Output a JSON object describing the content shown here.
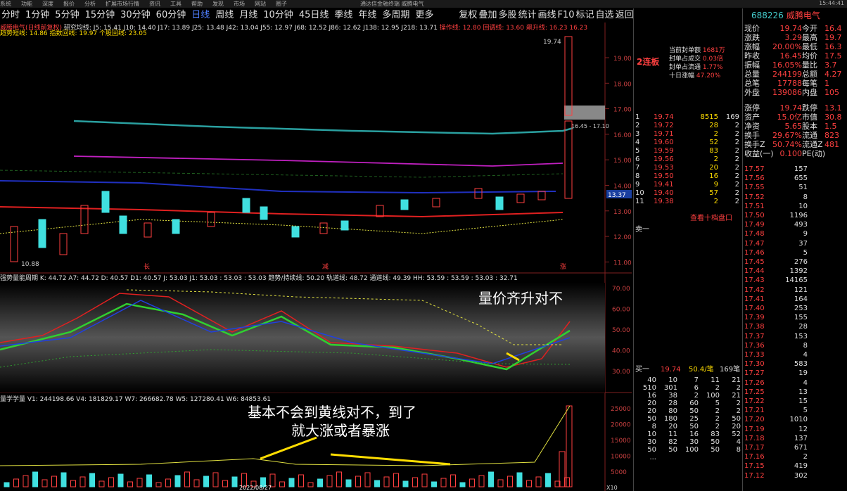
{
  "menu": [
    "系统",
    "功能",
    "深度",
    "报价",
    "分析",
    "扩展市场行情",
    "资讯",
    "工具",
    "帮助",
    "发现",
    "市场",
    "网站",
    "圈子"
  ],
  "window_title": "通达信金融终端  威腾电气",
  "clock": "15:44:41",
  "periods": [
    "分时",
    "1分钟",
    "5分钟",
    "15分钟",
    "30分钟",
    "60分钟",
    "日线",
    "周线",
    "月线",
    "10分钟",
    "45日线",
    "季线",
    "年线",
    "多周期",
    "更多"
  ],
  "selected_period": "日线",
  "toolbar_right": [
    "复权",
    "叠加",
    "多股",
    "统计",
    "画线",
    "F10",
    "标记",
    "自选",
    "返回"
  ],
  "chart": {
    "title": "威腾电气(日线前复权)",
    "legend1": "研究均线: J5: 15.41  J10: 14.40  J17: 13.89  J25: 13.48  J42: 13.04  J55: 12.97  J68: 12.52  J86: 12.62  J138: 12.95  J218: 13.71",
    "legend1b": "操作线: 12.80  回调线: 13.60  飙升线: 16.23  16.23",
    "legend2": "趋势短线: 14.86  指数回线: 19.97  个股回线: 23.05",
    "price_axis": [
      "19.00",
      "18.00",
      "17.00",
      "16.00",
      "15.00",
      "14.00",
      "13.00",
      "12.00",
      "11.00"
    ],
    "current_price": "13.37",
    "high_label": "19.74",
    "low_label": "10.88",
    "range_label": "16.45 - 17.10",
    "panel2_title": "强势量能周期  K: 44.72  A7: 44.72  D: 40.57  D1: 40.57  J: 53.03  J1: 53.03  : 53.03  : 53.03  趋势/持续线: 50.20  轨道线: 48.72  通道线: 49.39  HH: 53.59  : 53.59  : 53.03  : 32.71",
    "panel2_axis": [
      "70.00",
      "60.00",
      "50.00",
      "40.00",
      "30.00"
    ],
    "panel3_title": "量学学量  V1: 244198.66  V4: 181829.17  W7: 266682.78  W5: 127280.41  W6: 84853.61",
    "panel3_axis": [
      "25000",
      "20000",
      "15000",
      "10000",
      "5000"
    ],
    "date_label": "2022/08/27",
    "vol_unit": "X10",
    "annotation1": "量价齐升对不",
    "annotation2_line1": "基本不会到黄线对不，到了",
    "annotation2_line2": "就大涨或者暴涨",
    "xmarks": [
      "长",
      "减",
      "涨"
    ]
  },
  "side": {
    "streak": "2连板",
    "seal": [
      [
        "当前封单额",
        "1681万"
      ],
      [
        "封单占成交",
        "0.03倍"
      ],
      [
        "封单占流通",
        "1.77%"
      ],
      [
        "十日涨幅",
        "47.20%"
      ]
    ],
    "book_rows": [
      [
        "1",
        "19.74",
        "8515",
        "169"
      ],
      [
        "2",
        "19.72",
        "28",
        "2"
      ],
      [
        "3",
        "19.71",
        "2",
        "2"
      ],
      [
        "4",
        "19.60",
        "52",
        "2"
      ],
      [
        "5",
        "19.59",
        "83",
        "2"
      ],
      [
        "6",
        "19.56",
        "2",
        "2"
      ],
      [
        "7",
        "19.53",
        "20",
        "2"
      ],
      [
        "8",
        "19.50",
        "16",
        "2"
      ],
      [
        "9",
        "19.41",
        "9",
        "2"
      ],
      [
        "10",
        "19.40",
        "57",
        "2"
      ],
      [
        "11",
        "19.38",
        "2",
        "2"
      ]
    ],
    "ten_level": "查看十档盘口",
    "sell_label": "卖一",
    "buy_label": "买一",
    "buy_row": [
      "19.74",
      "50.4/笔",
      "169笔"
    ],
    "queue": [
      [
        "40",
        "10",
        "7",
        "11",
        "21"
      ],
      [
        "510",
        "301",
        "6",
        "2",
        "2"
      ],
      [
        "16",
        "38",
        "2",
        "100",
        "21"
      ],
      [
        "20",
        "28",
        "60",
        "5",
        "2"
      ],
      [
        "20",
        "80",
        "50",
        "2",
        "2"
      ],
      [
        "50",
        "180",
        "25",
        "2",
        "50"
      ],
      [
        "8",
        "20",
        "50",
        "2",
        "20"
      ],
      [
        "10",
        "11",
        "16",
        "83",
        "52"
      ],
      [
        "30",
        "82",
        "30",
        "50",
        "4"
      ],
      [
        "50",
        "50",
        "100",
        "50",
        "8"
      ],
      [
        "...",
        "",
        "",
        "",
        ""
      ]
    ]
  },
  "quote": {
    "code": "688226",
    "name": "威腾电气",
    "rows": [
      [
        "现价",
        "19.74",
        "今开",
        "16.4"
      ],
      [
        "涨跌",
        "3.29",
        "最高",
        "19.7"
      ],
      [
        "涨幅",
        "20.00%",
        "最低",
        "16.3"
      ],
      [
        "昨收",
        "16.45",
        "均价",
        "17.5"
      ],
      [
        "振幅",
        "16.05%",
        "量比",
        "3.7"
      ],
      [
        "总量",
        "244199",
        "总额",
        "4.27"
      ],
      [
        "总笔",
        "17788",
        "每笔",
        "1"
      ],
      [
        "外盘",
        "139086",
        "内盘",
        "105"
      ]
    ],
    "rows2": [
      [
        "涨停",
        "19.74",
        "跌停",
        "13.1"
      ],
      [
        "资产",
        "15.0亿",
        "市值",
        "30.8"
      ],
      [
        "净资",
        "5.65",
        "股本",
        "1.5"
      ],
      [
        "换手",
        "29.67%",
        "流通",
        "823"
      ],
      [
        "换手Z",
        "50.74%",
        "流通Z",
        "481"
      ],
      [
        "收益(一)",
        "0.100",
        "PE(动)",
        ""
      ]
    ],
    "ladder": [
      [
        "17.57",
        "157"
      ],
      [
        "17.56",
        "655"
      ],
      [
        "17.55",
        "51"
      ],
      [
        "17.52",
        "8"
      ],
      [
        "17.51",
        "10"
      ],
      [
        "17.50",
        "1196"
      ],
      [
        "17.49",
        "493"
      ],
      [
        "17.48",
        "9"
      ],
      [
        "17.47",
        "37"
      ],
      [
        "17.46",
        "5"
      ],
      [
        "17.45",
        "276"
      ],
      [
        "17.44",
        "1392"
      ],
      [
        "17.43",
        "14165"
      ],
      [
        "17.42",
        "121"
      ],
      [
        "17.41",
        "164"
      ],
      [
        "17.40",
        "253"
      ],
      [
        "17.39",
        "155"
      ],
      [
        "17.38",
        "28"
      ],
      [
        "17.37",
        "153"
      ],
      [
        "17.36",
        "8"
      ],
      [
        "17.33",
        "4"
      ],
      [
        "17.30",
        "583"
      ],
      [
        "17.27",
        "19"
      ],
      [
        "17.26",
        "4"
      ],
      [
        "17.25",
        "13"
      ],
      [
        "17.22",
        "15"
      ],
      [
        "17.21",
        "5"
      ],
      [
        "17.20",
        "1010"
      ],
      [
        "17.19",
        "12"
      ],
      [
        "17.18",
        "137"
      ],
      [
        "17.17",
        "671"
      ],
      [
        "17.16",
        "2"
      ],
      [
        "17.15",
        "419"
      ],
      [
        "17.12",
        "302"
      ]
    ]
  },
  "colors": {
    "up": "#ff4040",
    "down": "#40e0e0",
    "accent": "#4f7fff",
    "label": "#ffdd00"
  }
}
